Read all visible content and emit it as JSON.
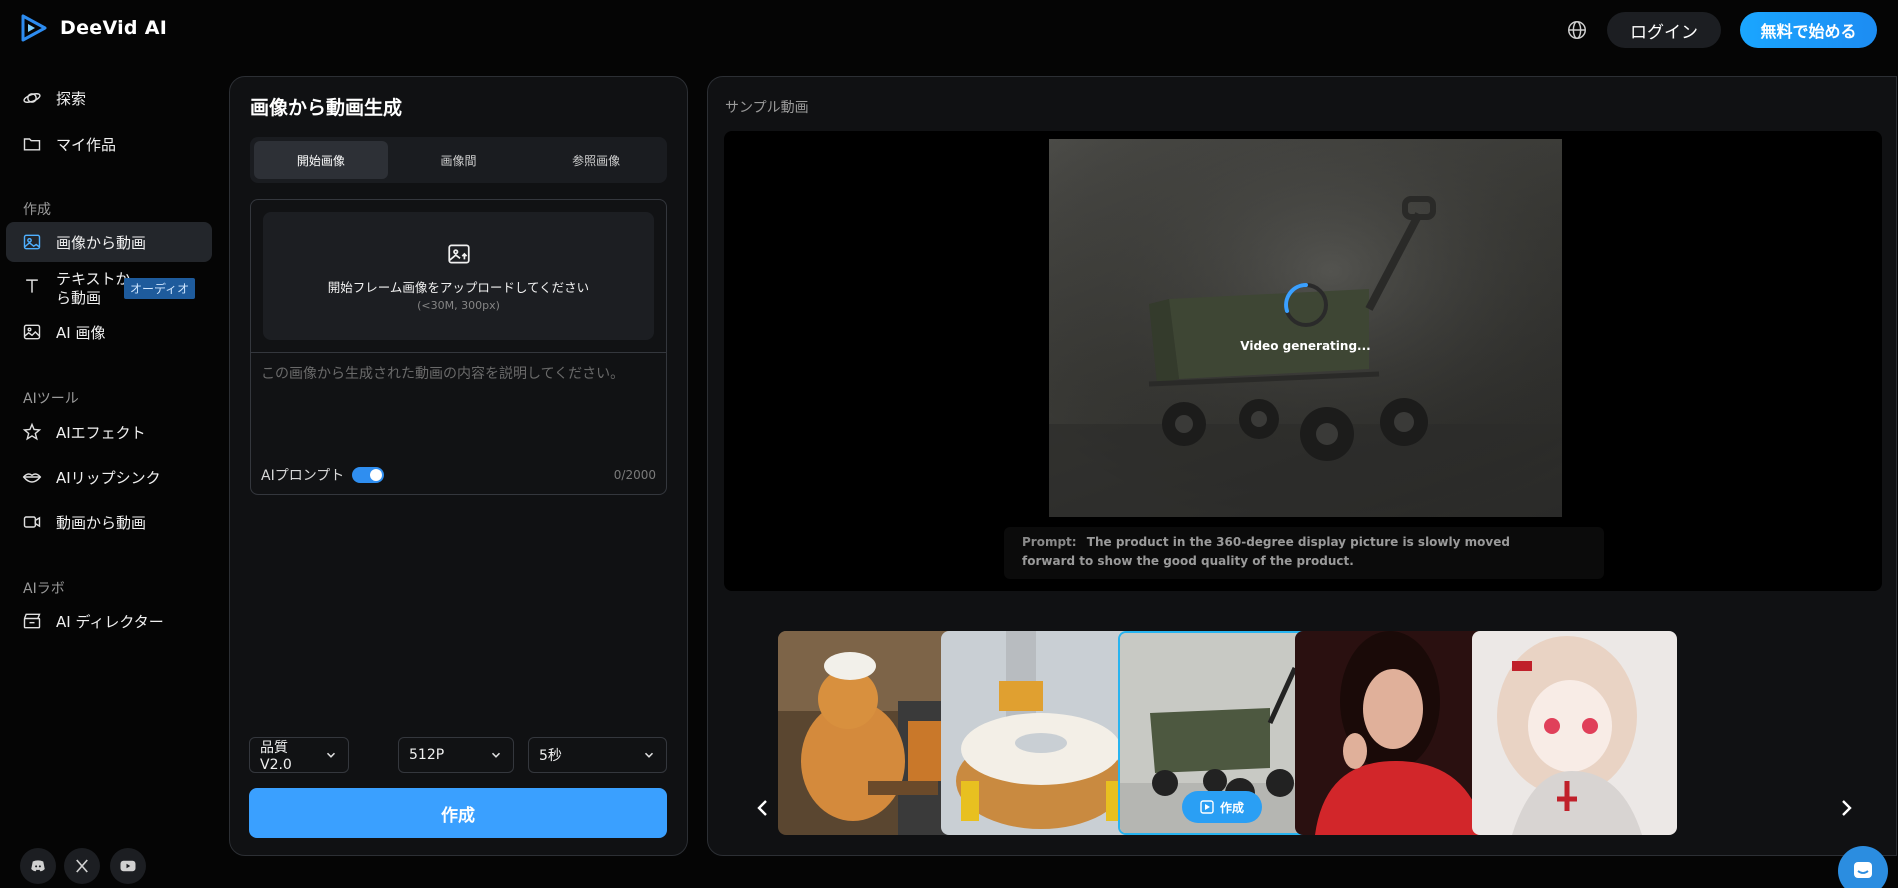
{
  "header": {
    "app_name": "DeeVid AI",
    "login_label": "ログイン",
    "start_label": "無料で始める"
  },
  "sidebar": {
    "top_items": [
      {
        "label": "探索",
        "icon": "planet-icon"
      },
      {
        "label": "マイ作品",
        "icon": "folder-icon"
      }
    ],
    "section_create": "作成",
    "create_items": [
      {
        "label": "画像から動画",
        "icon": "image-icon",
        "active": true
      },
      {
        "label_line1": "テキストか",
        "label_line2": "ら動画",
        "icon": "text-icon",
        "badge": "オーディオ"
      },
      {
        "label": "AI 画像",
        "icon": "gallery-icon"
      }
    ],
    "section_tools": "AIツール",
    "tool_items": [
      {
        "label": "AIエフェクト",
        "icon": "sparkle-icon"
      },
      {
        "label": "AIリップシンク",
        "icon": "lips-icon"
      },
      {
        "label": "動画から動画",
        "icon": "video-camera-icon"
      }
    ],
    "section_lab": "AIラボ",
    "lab_items": [
      {
        "label": "AI ディレクター",
        "icon": "clapper-icon"
      }
    ],
    "social": [
      "discord-icon",
      "x-icon",
      "youtube-icon"
    ]
  },
  "left_panel": {
    "title": "画像から動画生成",
    "tabs": [
      "開始画像",
      "画像間",
      "参照画像"
    ],
    "active_tab": 0,
    "upload_text": "開始フレーム画像をアップロードしてください",
    "upload_sub": "(<30M, 300px)",
    "prompt_placeholder": "この画像から生成された動画の内容を説明してください。",
    "ai_prompt_label": "AIプロンプト",
    "ai_prompt_on": true,
    "char_count": "0/2000",
    "quality_value": "品質 V2.0",
    "resolution_value": "512P",
    "duration_value": "5秒",
    "create_label": "作成"
  },
  "right_panel": {
    "title": "サンプル動画",
    "generating_text": "Video generating...",
    "prompt_label": "Prompt:",
    "prompt_line1": "The product in the 360-degree display picture is slowly moved",
    "prompt_line2": "forward to show the good quality of the product.",
    "thumb_button_label": "作成",
    "thumbnails": [
      "cat-baker",
      "donut-robot",
      "wagon",
      "woman-red-sweater",
      "anime-girl"
    ],
    "selected_thumb": 2
  },
  "colors": {
    "accent": "#3aa0ff",
    "background": "#050505",
    "panel": "#101113"
  }
}
